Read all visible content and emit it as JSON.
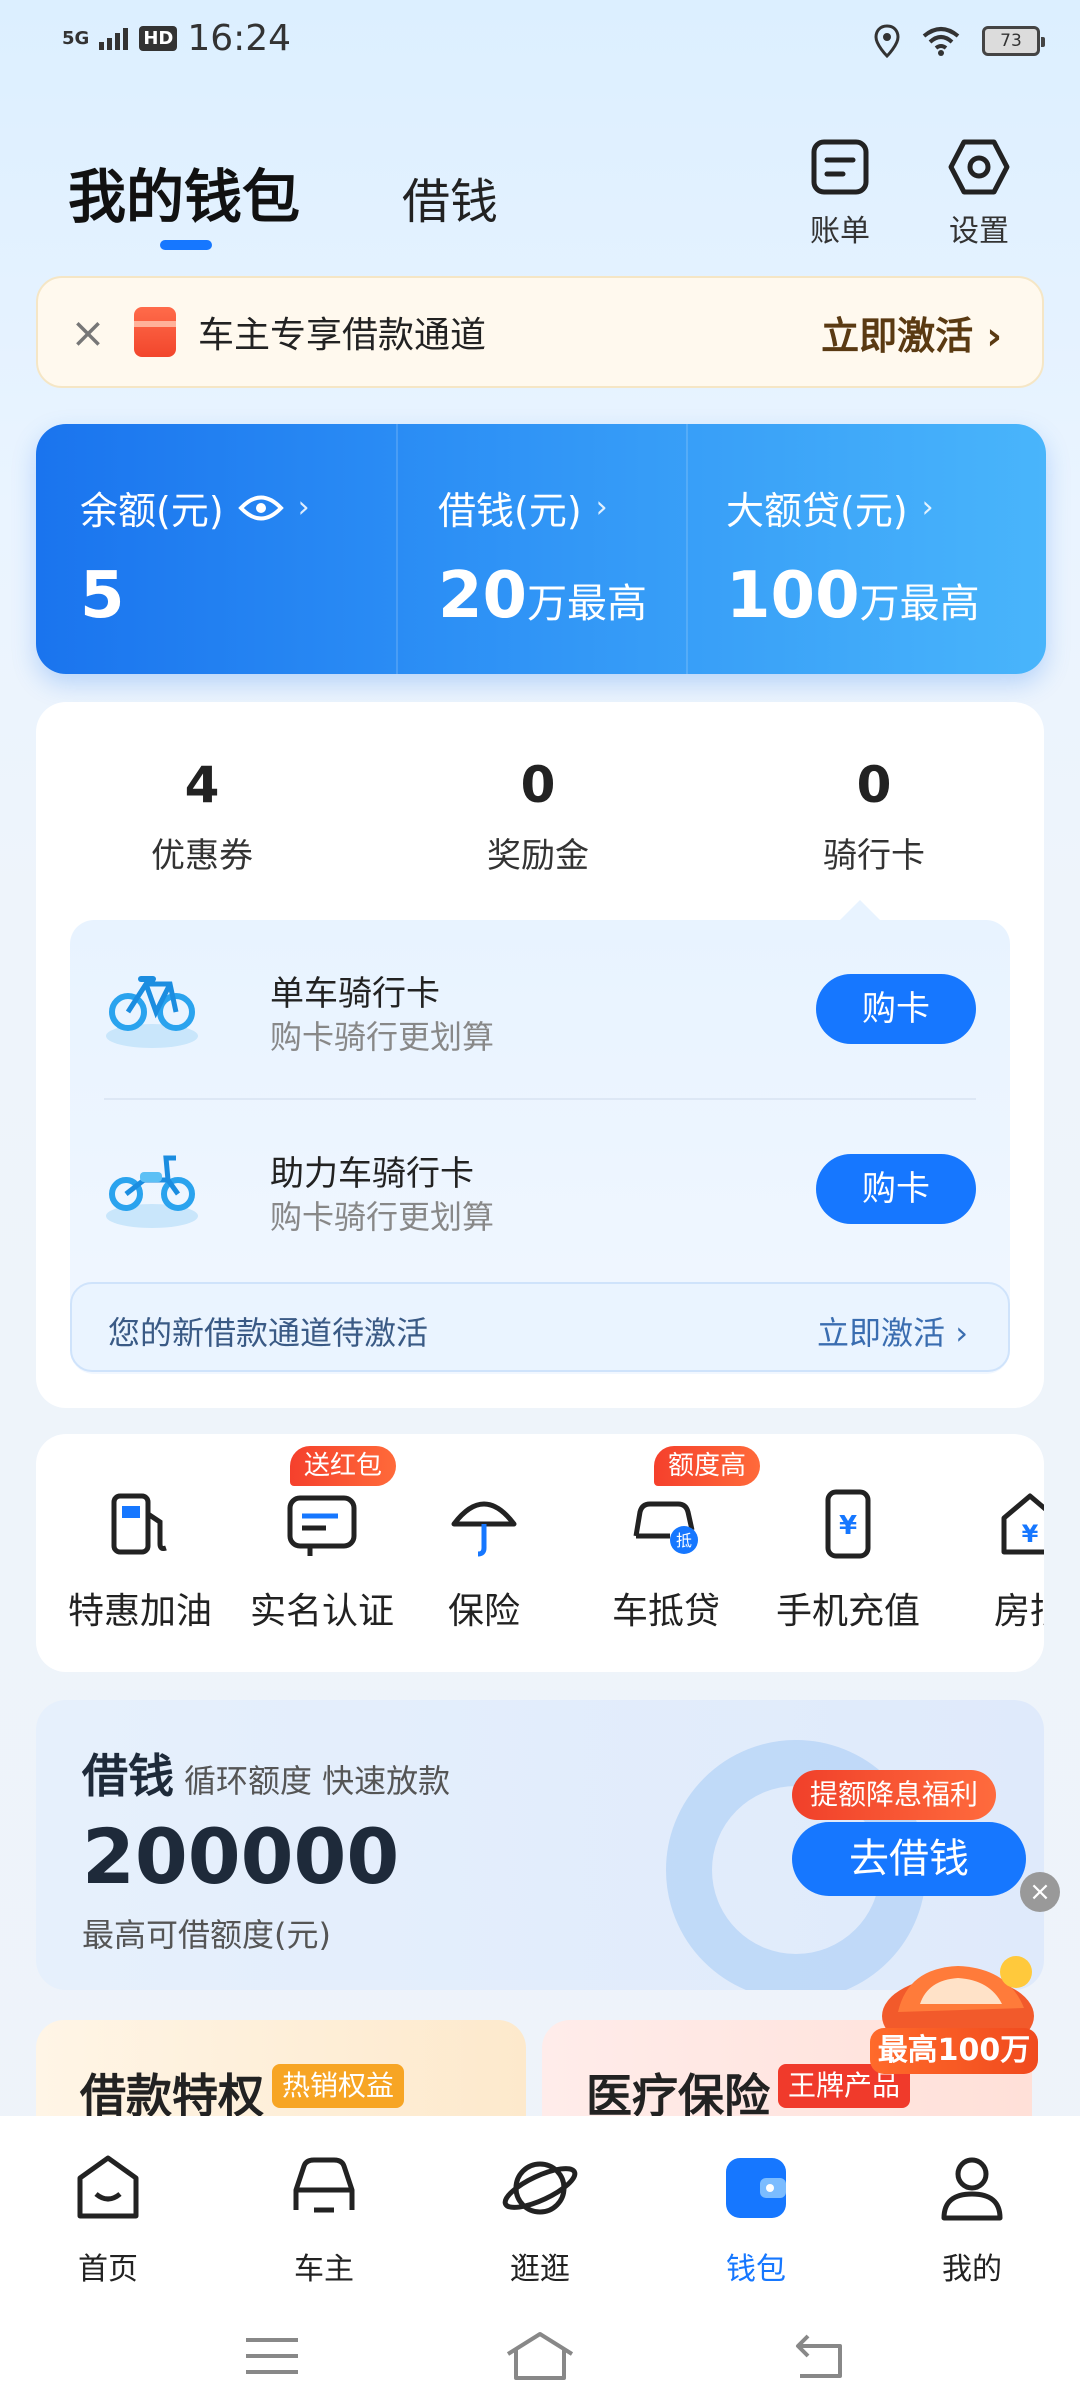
{
  "status_bar": {
    "signal": "5G",
    "hd": "HD",
    "time": "16:24",
    "battery": "73"
  },
  "header": {
    "tab_main": "我的钱包",
    "tab_borrow": "借钱",
    "bill_label": "账单",
    "settings_label": "设置"
  },
  "banner": {
    "text": "车主专享借款通道",
    "action": "立即激活 ›"
  },
  "balance_card": {
    "balance_label": "余额(元)",
    "balance_value": "5",
    "borrow_label": "借钱(元)",
    "borrow_value": "20",
    "borrow_unit": "万最高",
    "loan_label": "大额贷(元)",
    "loan_value": "100",
    "loan_unit": "万最高",
    "chevron": "›"
  },
  "stats": [
    {
      "value": "4",
      "label": "优惠券"
    },
    {
      "value": "0",
      "label": "奖励金"
    },
    {
      "value": "0",
      "label": "骑行卡"
    }
  ],
  "ride_cards": [
    {
      "title": "单车骑行卡",
      "subtitle": "购卡骑行更划算",
      "button": "购卡"
    },
    {
      "title": "助力车骑行卡",
      "subtitle": "购卡骑行更划算",
      "button": "购卡"
    }
  ],
  "new_channel": {
    "text": "您的新借款通道待激活",
    "action": "立即激活 ›"
  },
  "services": [
    {
      "label": "特惠加油",
      "badge": ""
    },
    {
      "label": "实名认证",
      "badge": "送红包"
    },
    {
      "label": "保险",
      "badge": ""
    },
    {
      "label": "车抵贷",
      "badge": "额度高"
    },
    {
      "label": "手机充值",
      "badge": ""
    },
    {
      "label": "房抵",
      "badge": ""
    }
  ],
  "borrow_card": {
    "title": "借钱",
    "tags": "循环额度 快速放款",
    "amount": "200000",
    "sub": "最高可借额度(元)",
    "badge": "提额降息福利",
    "button": "去借钱"
  },
  "float_ad": {
    "text": "最高100万",
    "close": "×"
  },
  "promos": [
    {
      "title": "借款特权",
      "badge": "热销权益",
      "badge_color": "#f7a524"
    },
    {
      "title": "医疗保险",
      "badge": "王牌产品",
      "badge_color": "#f03a2b"
    }
  ],
  "bottom_nav": [
    {
      "label": "首页",
      "icon": "home-icon"
    },
    {
      "label": "车主",
      "icon": "car-icon"
    },
    {
      "label": "逛逛",
      "icon": "planet-icon"
    },
    {
      "label": "钱包",
      "icon": "wallet-icon",
      "active": true
    },
    {
      "label": "我的",
      "icon": "profile-icon"
    }
  ],
  "colors": {
    "accent": "#1677ff",
    "badge_red": "#f5402c"
  }
}
